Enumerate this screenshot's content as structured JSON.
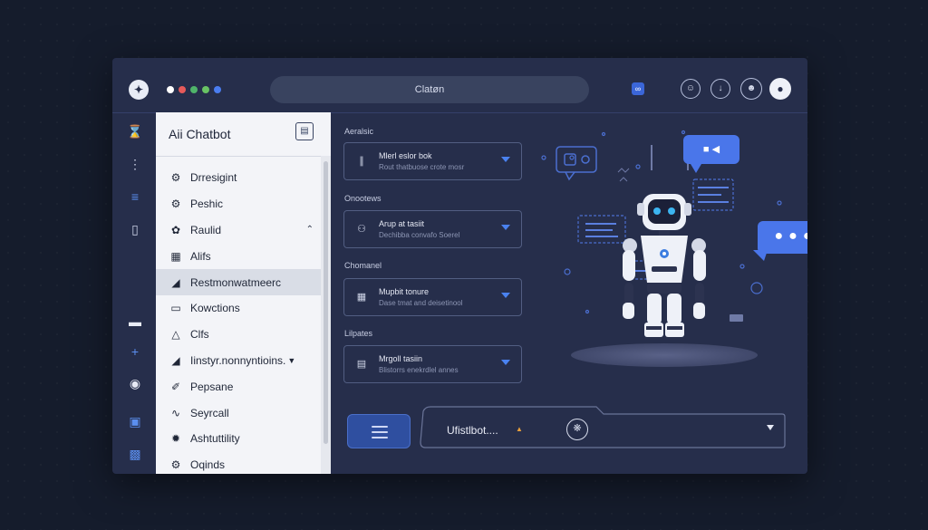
{
  "titlebar": {
    "address": "Clatøn",
    "window_dot_colors": [
      "#ffffff",
      "#e65a5a",
      "#4fb46a",
      "#69c364",
      "#4a7df0"
    ],
    "extension_icon": "extension-icon",
    "header_icons": [
      "bot-face-icon",
      "download-icon",
      "profile-icon",
      "avatar-icon"
    ]
  },
  "rail": {
    "icons": [
      "crop-icon",
      "more-vertical-icon",
      "menu-icon",
      "phone-icon",
      "window-icon",
      "plus-icon",
      "globe-icon",
      "layout-icon",
      "gamepad-icon"
    ]
  },
  "sidebar": {
    "title": "Aii Chatbot",
    "items": [
      {
        "icon": "gear-icon",
        "label": "Drresigint"
      },
      {
        "icon": "gear-icon",
        "label": "Peshic"
      },
      {
        "icon": "palette-icon",
        "label": "Raulid",
        "expandable": true
      },
      {
        "icon": "grid-icon",
        "label": "Alifs"
      },
      {
        "icon": "chart-icon",
        "label": "Restmonwatmeerc",
        "active": true
      },
      {
        "icon": "document-icon",
        "label": "Kowctions"
      },
      {
        "icon": "warning-icon",
        "label": "Clfs"
      },
      {
        "icon": "chart-icon",
        "label": "Iinstyr.nonnyntioins.",
        "dropdown": true
      },
      {
        "icon": "tag-icon",
        "label": "Pepsane"
      },
      {
        "icon": "swirl-icon",
        "label": "Seyrcall"
      },
      {
        "icon": "network-icon",
        "label": "Ashtuttility"
      },
      {
        "icon": "gear-icon",
        "label": "Oqinds"
      }
    ]
  },
  "settings": [
    {
      "label": "Aeralsic",
      "icon": "audio-wave-icon",
      "title": "Mlerl eslor bok",
      "subtitle": "Rout thatbuose crote mosr"
    },
    {
      "label": "Onootews",
      "icon": "robot-icon",
      "title": "Arup at tasiit",
      "subtitle": "Dechibba convafo Soerel"
    },
    {
      "label": "Chomanel",
      "icon": "table-icon",
      "title": "Mupbit tonure",
      "subtitle": "Dase tmat and deisetinool"
    },
    {
      "label": "Lilpates",
      "icon": "image-icon",
      "title": "Mrgoll tasiin",
      "subtitle": "Blistorrs enekrdlel annes"
    }
  ],
  "composer": {
    "text": "Ufistlbot....",
    "warning_icon": "warning-icon",
    "emoji_icon": "emoji-icon",
    "dropdown_icon": "chevron-down-icon"
  },
  "colors": {
    "background": "#151c2c",
    "window": "#262e4b",
    "accent": "#4a76ea",
    "sidebar": "#f3f4f8"
  }
}
